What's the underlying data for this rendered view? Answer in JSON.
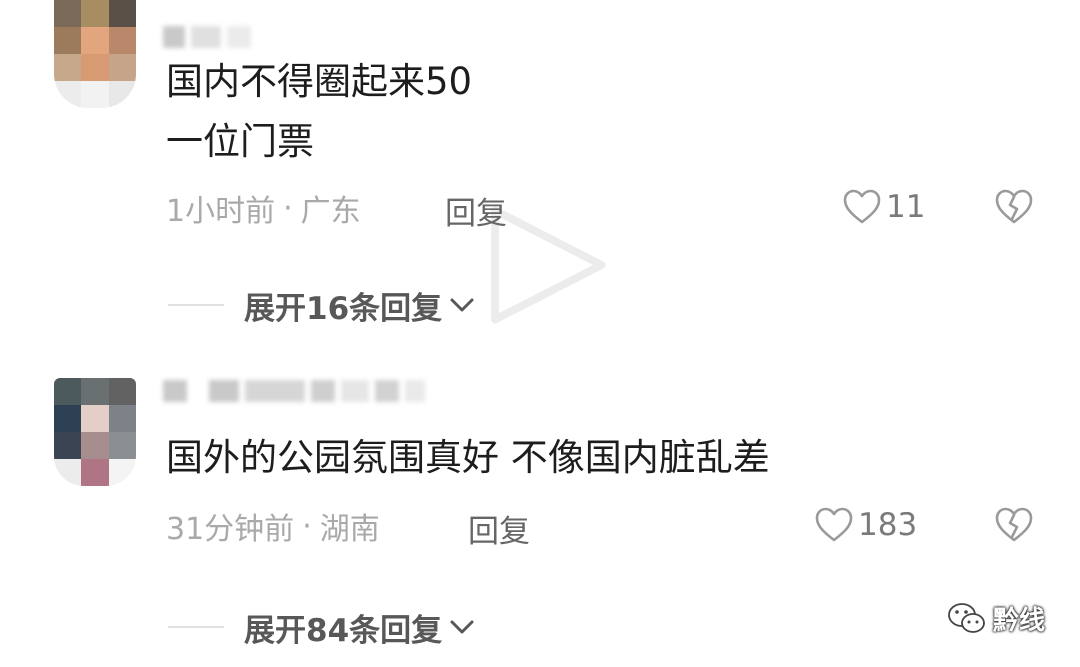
{
  "comments": [
    {
      "text": "国内不得圈起来50\n一位门票",
      "time": "1小时前",
      "location": "广东",
      "reply_label": "回复",
      "likes": "11",
      "expand_label": "展开16条回复"
    },
    {
      "text": "国外的公园氛围真好 不像国内脏乱差",
      "time": "31分钟前",
      "location": "湖南",
      "reply_label": "回复",
      "likes": "183",
      "expand_label": "展开84条回复"
    }
  ],
  "separator": "·",
  "watermark": {
    "text": "黔线"
  },
  "colors": {
    "text_primary": "#1d1d1d",
    "text_meta": "#a9a9a9",
    "reply": "#666666",
    "expand": "#585858",
    "icon": "#9a9a9a"
  },
  "icons": {
    "like": "heart-outline-icon",
    "dislike": "broken-heart-icon",
    "expand": "chevron-down-icon",
    "watermark": "wechat-icon"
  }
}
